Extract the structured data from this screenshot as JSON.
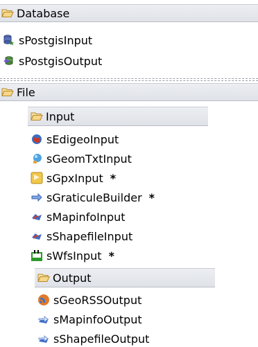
{
  "database": {
    "header": "Database",
    "items": [
      {
        "label": "sPostgisInput",
        "icon": "database-icon"
      },
      {
        "label": "sPostgisOutput",
        "icon": "database-icon"
      }
    ]
  },
  "file": {
    "header": "File",
    "input": {
      "header": "Input",
      "items": [
        {
          "label": "sEdigeoInput",
          "icon": "globe-icon",
          "star": ""
        },
        {
          "label": "sGeomTxtInput",
          "icon": "bulb-icon",
          "star": ""
        },
        {
          "label": "sGpxInput",
          "icon": "gpx-icon",
          "star": "*"
        },
        {
          "label": "sGraticuleBuilder",
          "icon": "arrow-icon",
          "star": "*"
        },
        {
          "label": "sMapinfoInput",
          "icon": "map-icon",
          "star": ""
        },
        {
          "label": "sShapefileInput",
          "icon": "map-icon",
          "star": ""
        },
        {
          "label": "sWfsInput",
          "icon": "wfs-icon",
          "star": "*"
        }
      ]
    },
    "output": {
      "header": "Output",
      "items": [
        {
          "label": "sGeoRSSOutput",
          "icon": "rss-globe-icon"
        },
        {
          "label": "sMapinfoOutput",
          "icon": "map-arrow-icon"
        },
        {
          "label": "sShapefileOutput",
          "icon": "map-arrow-icon"
        }
      ]
    }
  },
  "colors": {
    "folder_fill": "#f6d78a",
    "folder_stroke": "#b8892c"
  }
}
